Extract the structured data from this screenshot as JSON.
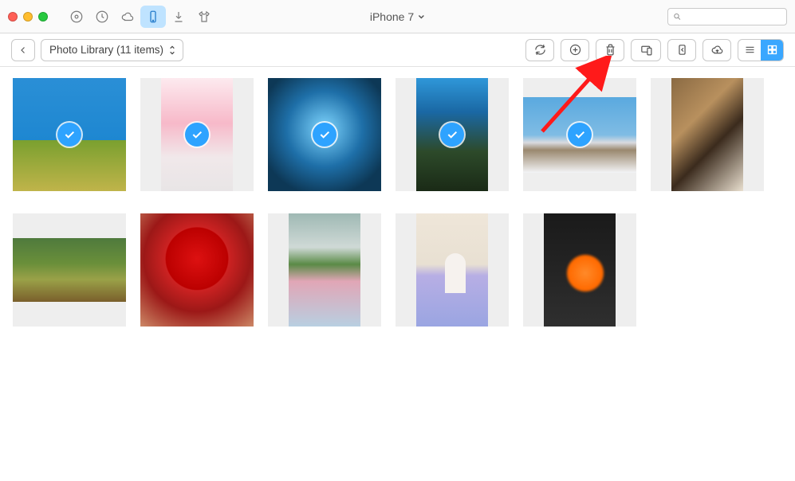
{
  "device": {
    "name": "iPhone 7"
  },
  "search": {
    "placeholder": ""
  },
  "library_selector": {
    "label": "Photo Library (11 items)"
  },
  "toolbar_top": {
    "icons": [
      "music-icon",
      "history-icon",
      "cloud-icon",
      "phone-icon",
      "download-icon",
      "tshirt-icon"
    ],
    "active_index": 3
  },
  "actions": {
    "refresh": "refresh-icon",
    "add": "add-icon",
    "delete": "trash-icon",
    "to_device": "to-device-icon",
    "to_mac": "to-mac-icon",
    "to_cloud": "to-cloud-icon"
  },
  "view": {
    "mode": "grid"
  },
  "annotation": {
    "points_to": "delete"
  },
  "photos": [
    {
      "selected": true,
      "shape": "square",
      "desc": "blue sky with trees"
    },
    {
      "selected": true,
      "shape": "portrait",
      "desc": "pink flowers in vase"
    },
    {
      "selected": true,
      "shape": "square",
      "desc": "blue butterflies over water"
    },
    {
      "selected": true,
      "shape": "portrait",
      "desc": "tall trees and blue sky"
    },
    {
      "selected": true,
      "shape": "landscape",
      "desc": "snowy mountains under sky"
    },
    {
      "selected": false,
      "shape": "portrait",
      "desc": "food on wooden table"
    },
    {
      "selected": false,
      "shape": "landscape",
      "desc": "autumn mountain valley"
    },
    {
      "selected": false,
      "shape": "square",
      "desc": "red heart-shaped tree"
    },
    {
      "selected": false,
      "shape": "portrait",
      "desc": "potted plant on desk"
    },
    {
      "selected": false,
      "shape": "portrait",
      "desc": "girl in field of flowers"
    },
    {
      "selected": false,
      "shape": "portrait",
      "desc": "orange flowers at night"
    }
  ]
}
